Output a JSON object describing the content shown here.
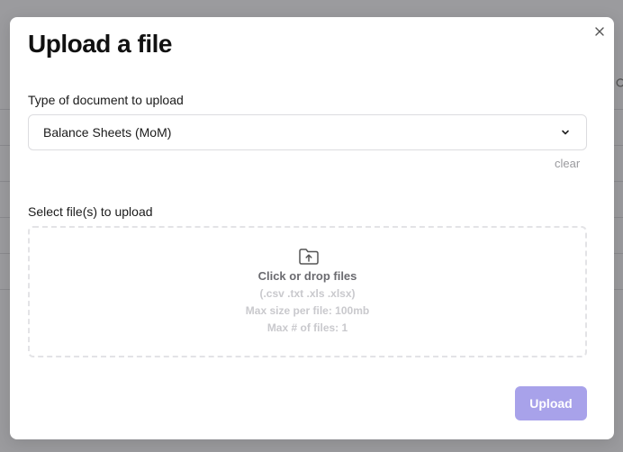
{
  "modal": {
    "title": "Upload a file",
    "close_icon": "close-icon"
  },
  "document_type": {
    "label": "Type of document to upload",
    "selected": "Balance Sheets (MoM)",
    "chevron_icon": "chevron-down-icon",
    "clear_label": "clear"
  },
  "file_select": {
    "label": "Select file(s) to upload",
    "icon": "folder-upload-icon",
    "prompt": "Click or drop files",
    "formats": "(.csv .txt .xls .xlsx)",
    "max_size": "Max size per file: 100mb",
    "max_count": "Max # of files: 1"
  },
  "actions": {
    "upload_label": "Upload"
  },
  "colors": {
    "primary_button": "#a8a2ea",
    "backdrop": "#9b9b9e"
  }
}
